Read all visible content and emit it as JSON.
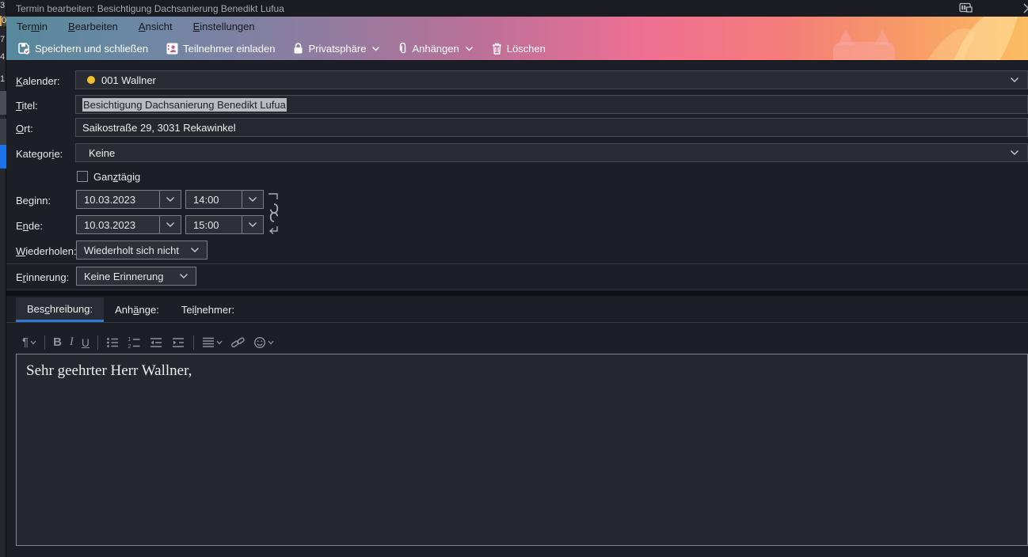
{
  "window": {
    "title": "Termin bearbeiten: Besichtigung Dachsanierung Benedikt Lufua"
  },
  "left_strip": {
    "digits": [
      "3",
      "0",
      "7",
      "4",
      "1"
    ]
  },
  "menubar": {
    "items": [
      {
        "label": "Termin",
        "accesskey": "m"
      },
      {
        "label": "Bearbeiten",
        "accesskey": "B"
      },
      {
        "label": "Ansicht",
        "accesskey": "A"
      },
      {
        "label": "Einstellungen",
        "accesskey": "E"
      }
    ]
  },
  "toolbar": {
    "buttons": [
      {
        "label": "Speichern und schließen",
        "icon": "save-close-icon",
        "has_dropdown": false
      },
      {
        "label": "Teilnehmer einladen",
        "icon": "invite-attendees-icon",
        "has_dropdown": false
      },
      {
        "label": "Privatsphäre",
        "icon": "lock-icon",
        "has_dropdown": true
      },
      {
        "label": "Anhängen",
        "icon": "paperclip-icon",
        "has_dropdown": true
      },
      {
        "label": "Löschen",
        "icon": "trash-icon",
        "has_dropdown": false
      }
    ]
  },
  "form": {
    "calendar": {
      "label": "Kalender:",
      "accesskey": "K",
      "value": "001 Wallner"
    },
    "title": {
      "label": "Titel:",
      "accesskey": "T",
      "value": "Besichtigung Dachsanierung Benedikt Lufua",
      "selected": true
    },
    "location": {
      "label": "Ort:",
      "accesskey": "O",
      "value": "Saikostraße 29, 3031 Rekawinkel"
    },
    "category": {
      "label": "Kategorie:",
      "accesskey": "i",
      "value": "Keine"
    },
    "allday": {
      "label": "Ganztägig",
      "accesskey": "z",
      "checked": false
    },
    "start": {
      "label": "Beginn:",
      "date": "10.03.2023",
      "time": "14:00"
    },
    "end": {
      "label": "Ende:",
      "accesskey": "n",
      "date": "10.03.2023",
      "time": "15:00"
    },
    "repeat": {
      "label": "Wiederholen:",
      "accesskey": "W",
      "value": "Wiederholt sich nicht"
    },
    "reminder": {
      "label": "Erinnerung:",
      "accesskey": "r",
      "value": "Keine Erinnerung"
    }
  },
  "tabs": [
    {
      "label": "Beschreibung:",
      "accesskey": "c",
      "active": true
    },
    {
      "label": "Anhänge:",
      "accesskey": "ä",
      "active": false
    },
    {
      "label": "Teilnehmer:",
      "accesskey": "l",
      "active": false
    }
  ],
  "editor": {
    "toolbar_icons": [
      "paragraph-format",
      "bold",
      "italic",
      "underline",
      "bullet-list",
      "numbered-list",
      "outdent",
      "indent",
      "align",
      "link",
      "emoji"
    ],
    "bold_glyph": "B",
    "italic_glyph": "I",
    "underline_glyph": "U",
    "paragraph_glyph": "¶",
    "content": "Sehr geehrter Herr Wallner,"
  },
  "colors": {
    "calendar_dot": "#f2c12e",
    "active_tab_underline": "#2e7cd6",
    "selection_bg": "#b9bbc0",
    "strip_blue": "#1a73e8",
    "gradient_left": "#57889c",
    "gradient_mid": "#ee6f94",
    "gradient_right": "#fbbd62"
  }
}
